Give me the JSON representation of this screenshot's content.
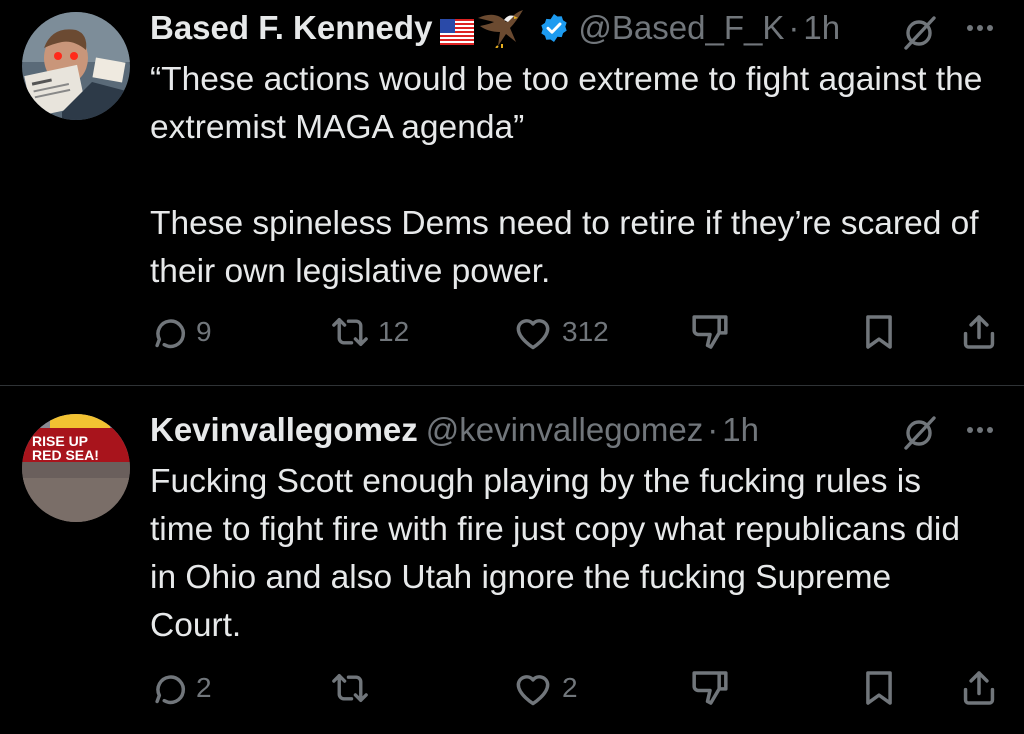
{
  "tweets": [
    {
      "author_name": "Based F. Kennedy",
      "author_badges": [
        "us-flag-emoji",
        "eagle-emoji",
        "verified-badge-icon"
      ],
      "handle": "@Based_F_K",
      "separator": "·",
      "time": "1h",
      "text": "“These actions would be too extreme to fight against the extremist MAGA agenda”\n\nThese spineless Dems need to retire if they’re scared of their own legislative power.",
      "replies": "9",
      "reposts": "12",
      "likes": "312"
    },
    {
      "author_name": "Kevinvallegomez",
      "handle": "@kevinvallegomez",
      "separator": "·",
      "time": "1h",
      "avatar_text_line1": "RISE UP",
      "avatar_text_line2": "RED SEA!",
      "text": "Fucking Scott enough playing by the fucking rules is time to fight fire with fire just copy what republicans did in Ohio and also Utah ignore the fucking Supreme Court.",
      "replies": "2",
      "reposts": "",
      "likes": "2"
    }
  ],
  "colors": {
    "background": "#000000",
    "text": "#e7e9ea",
    "secondary": "#71767b",
    "verified": "#1d9bf0",
    "divider": "#2f3336"
  }
}
